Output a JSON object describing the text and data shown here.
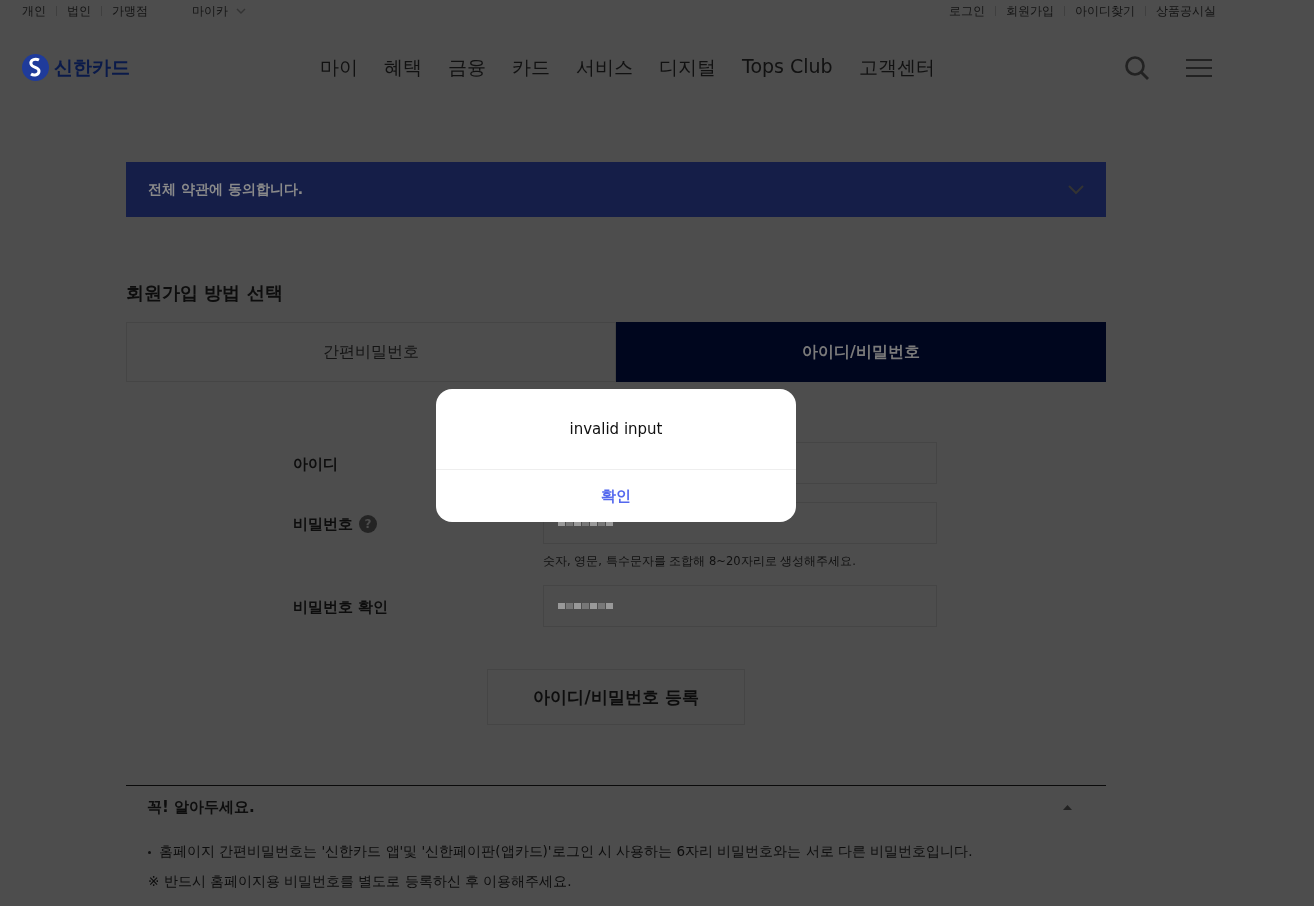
{
  "utility_nav": {
    "left": [
      "개인",
      "법인",
      "가맹점"
    ],
    "dropdown": "마이카",
    "right": [
      "로그인",
      "회원가입",
      "아이디찾기",
      "상품공시실"
    ]
  },
  "header": {
    "logo": "신한카드",
    "menu": [
      "마이",
      "혜택",
      "금융",
      "카드",
      "서비스",
      "디지털",
      "Tops Club",
      "고객센터"
    ]
  },
  "agree_banner": {
    "label": "전체 약관에 동의합니다.",
    "expanded": false
  },
  "section_title": "회원가입 방법 선택",
  "tabs": [
    {
      "label": "간편비밀번호",
      "selected": false
    },
    {
      "label": "아이디/비밀번호",
      "selected": true
    }
  ],
  "form": [
    {
      "label": "아이디"
    },
    {
      "label": "비밀번호",
      "help": "?",
      "filled": true,
      "hint": "숫자, 영문, 특수문자를 조합해 8~20자리로 생성해주세요."
    },
    {
      "label": "비밀번호 확인",
      "filled": true
    }
  ],
  "register_button": "아이디/비밀번호 등록",
  "notice": {
    "title": "꼭! 알아두세요.",
    "expanded": true,
    "items": [
      {
        "kind": "bullet",
        "text": "홈페이지 간편비밀번호는 '신한카드 앱'및 '신한페이판(앱카드)'로그인 시 사용하는 6자리 비밀번호와는 서로 다른 비밀번호입니다."
      },
      {
        "kind": "note",
        "text": "※ 반드시 홈페이지용 비밀번호를 별도로 등록하신 후 이용해주세요."
      }
    ]
  },
  "dialog": {
    "message": "invalid input",
    "button": "확인"
  }
}
